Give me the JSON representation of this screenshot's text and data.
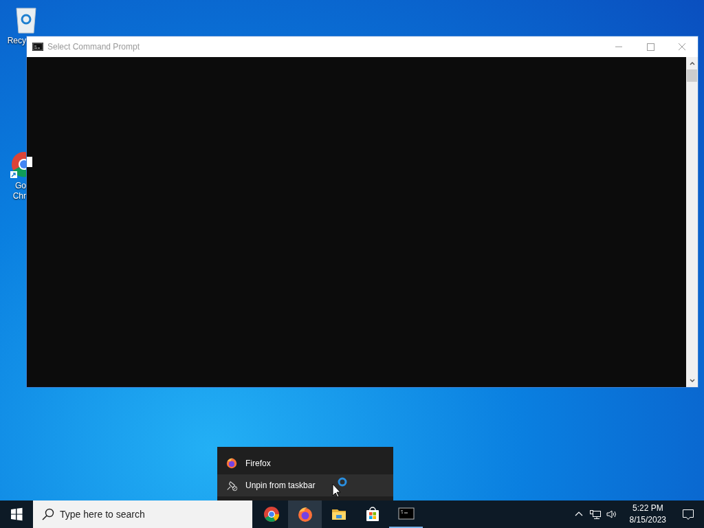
{
  "desktop_icons": [
    {
      "kind": "recycle",
      "lines": [
        "Recy"
      ]
    },
    {
      "kind": "chrome",
      "lines": [
        "Go",
        "Chr"
      ]
    }
  ],
  "window": {
    "title": "Select Command Prompt",
    "active": false
  },
  "context_menu": {
    "items": [
      {
        "kind": "firefox",
        "label": "Firefox",
        "selected": false
      },
      {
        "kind": "unpin",
        "label": "Unpin from taskbar",
        "selected": true
      }
    ]
  },
  "taskbar": {
    "search": {
      "placeholder": "Type here to search"
    },
    "apps": [
      {
        "kind": "chrome",
        "selected": false,
        "running": false
      },
      {
        "kind": "firefox",
        "selected": true,
        "running": false
      },
      {
        "kind": "explorer",
        "selected": false,
        "running": false
      },
      {
        "kind": "store",
        "selected": false,
        "running": false
      },
      {
        "kind": "cmd",
        "selected": false,
        "running": true
      }
    ],
    "time": "5:22 PM",
    "date": "8/15/2023"
  }
}
